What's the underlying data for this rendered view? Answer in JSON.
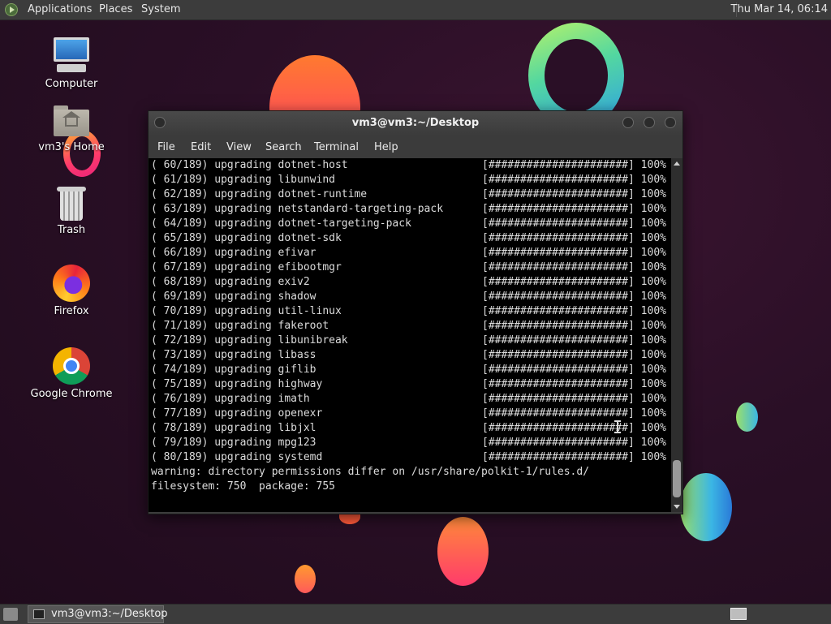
{
  "top_panel": {
    "menus": [
      "Applications",
      "Places",
      "System"
    ],
    "clock": "Thu Mar 14, 06:14"
  },
  "desktop_icons": [
    "Computer",
    "vm3's Home",
    "Trash",
    "Firefox",
    "Google Chrome"
  ],
  "window": {
    "title": "vm3@vm3:~/Desktop",
    "menu": [
      "File",
      "Edit",
      "View",
      "Search",
      "Terminal",
      "Help"
    ],
    "progress_bar": "[######################] 100%",
    "lines": [
      "( 60/189) upgrading dotnet-host",
      "( 61/189) upgrading libunwind",
      "( 62/189) upgrading dotnet-runtime",
      "( 63/189) upgrading netstandard-targeting-pack",
      "( 64/189) upgrading dotnet-targeting-pack",
      "( 65/189) upgrading dotnet-sdk",
      "( 66/189) upgrading efivar",
      "( 67/189) upgrading efibootmgr",
      "( 68/189) upgrading exiv2",
      "( 69/189) upgrading shadow",
      "( 70/189) upgrading util-linux",
      "( 71/189) upgrading fakeroot",
      "( 72/189) upgrading libunibreak",
      "( 73/189) upgrading libass",
      "( 74/189) upgrading giflib",
      "( 75/189) upgrading highway",
      "( 76/189) upgrading imath",
      "( 77/189) upgrading openexr",
      "( 78/189) upgrading libjxl",
      "( 79/189) upgrading mpg123",
      "( 80/189) upgrading systemd"
    ],
    "tail": [
      "warning: directory permissions differ on /usr/share/polkit-1/rules.d/",
      "filesystem: 750  package: 755"
    ]
  },
  "taskbar": {
    "task_label": "vm3@vm3:~/Desktop"
  }
}
